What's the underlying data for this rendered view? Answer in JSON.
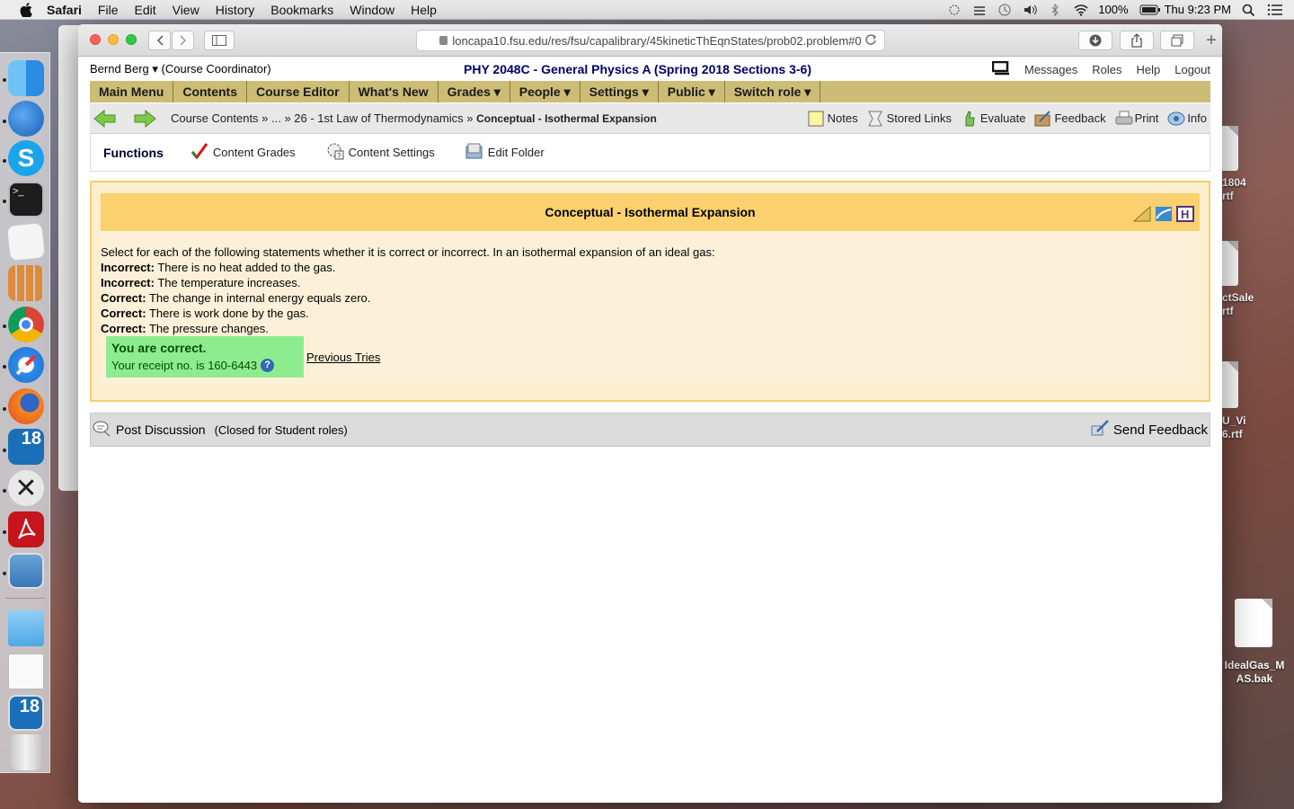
{
  "menubar": {
    "app": "Safari",
    "items": [
      "File",
      "Edit",
      "View",
      "History",
      "Bookmarks",
      "Window",
      "Help"
    ],
    "battery": "100%",
    "clock": "Thu 9:23 PM"
  },
  "desktop": {
    "files": [
      {
        "label": "1804\nrtf"
      },
      {
        "label": "ctSale\nrtf"
      },
      {
        "label": "U_Vi\n6.rtf"
      },
      {
        "label": "IdealGas_M\nAS.bak"
      }
    ]
  },
  "browser": {
    "url": "loncapa10.fsu.edu/res/fsu/capalibrary/45kineticThEqnStates/prob02.problem#0"
  },
  "header": {
    "user": "Bernd Berg ▾ (Course Coordinator)",
    "course": "PHY 2048C - General Physics A (Spring 2018 Sections 3-6)",
    "links": [
      "Messages",
      "Roles",
      "Help",
      "Logout"
    ]
  },
  "mainmenu": {
    "items": [
      "Main Menu",
      "Contents",
      "Course Editor",
      "What's New",
      "Grades ▾",
      "People ▾",
      "Settings ▾",
      "Public ▾",
      "Switch role ▾"
    ]
  },
  "breadcrumb": {
    "path": "Course Contents » ... » 26 - 1st Law of Thermodynamics » ",
    "current": "Conceptual - Isothermal Expansion"
  },
  "navtools": {
    "notes": "Notes",
    "stored_links": "Stored Links",
    "evaluate": "Evaluate",
    "feedback": "Feedback",
    "print": "Print",
    "info": "Info"
  },
  "functions": {
    "title": "Functions",
    "content_grades": "Content Grades",
    "content_settings": "Content Settings",
    "edit_folder": "Edit Folder"
  },
  "problem": {
    "title": "Conceptual - Isothermal Expansion",
    "question": "Select for each of the following statements whether it is correct or incorrect. In an isothermal expansion of an ideal gas:",
    "statements": [
      {
        "answer": "Incorrect:",
        "text": " There is no heat added to the gas."
      },
      {
        "answer": "Incorrect:",
        "text": " The temperature increases."
      },
      {
        "answer": "Correct:",
        "text": " The change in internal energy equals zero."
      },
      {
        "answer": "Correct:",
        "text": " There is work done by the gas."
      },
      {
        "answer": "Correct:",
        "text": " The pressure changes."
      }
    ],
    "result": "You are correct.",
    "receipt": "Your receipt no. is 160-6443",
    "previous_tries": "Previous Tries"
  },
  "discussion": {
    "post": "Post Discussion",
    "closed": "(Closed for Student roles)",
    "send_feedback": "Send Feedback"
  }
}
